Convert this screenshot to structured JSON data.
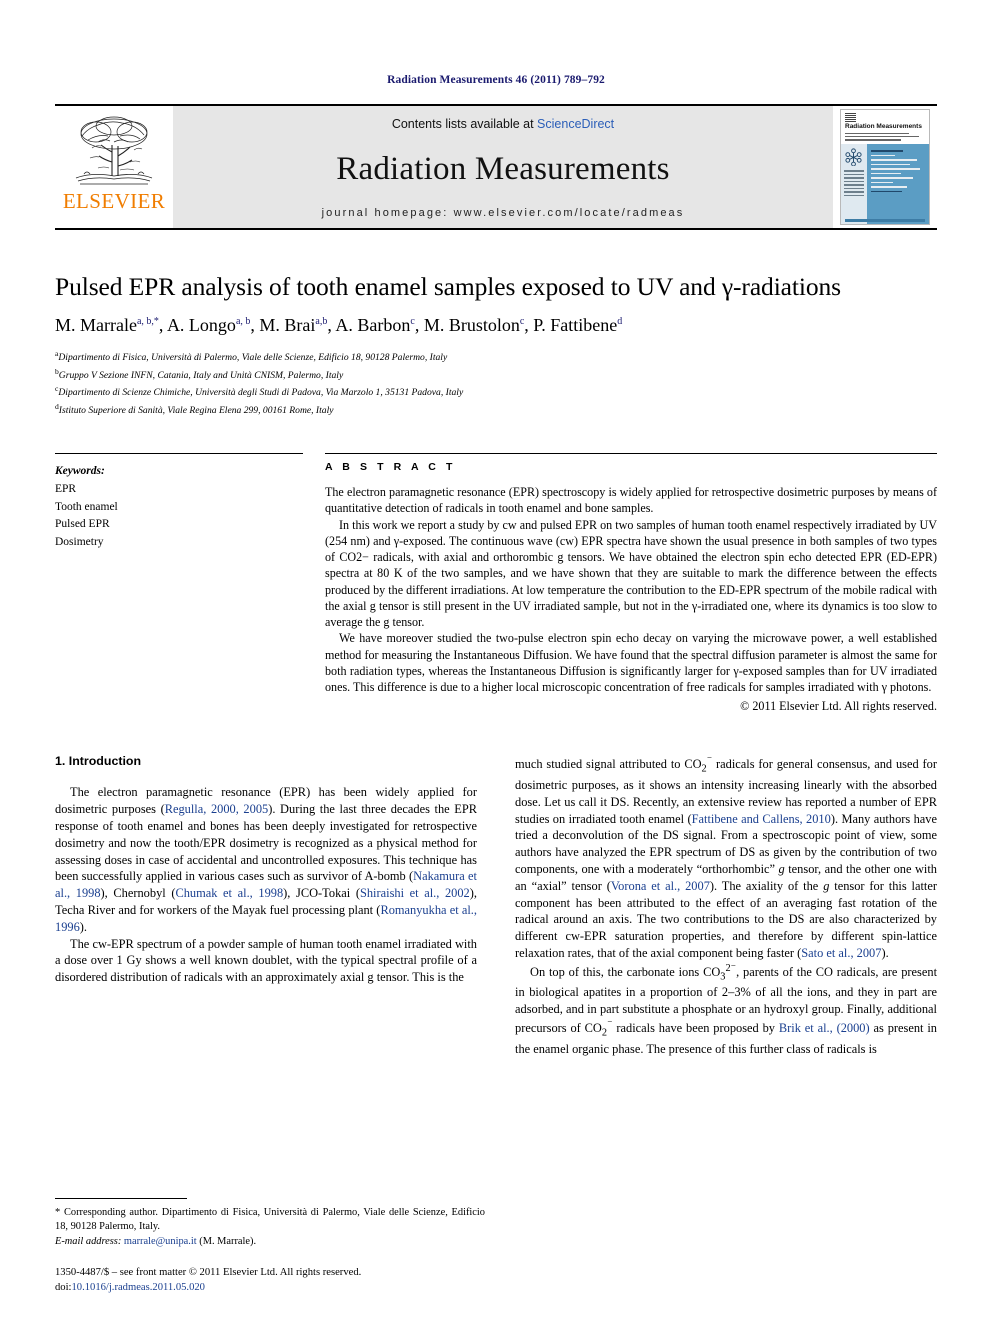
{
  "running_head": "Radiation Measurements 46 (2011) 789–792",
  "masthead": {
    "publisher": "ELSEVIER",
    "contents_prefix": "Contents lists available at ",
    "sciencedirect": "ScienceDirect",
    "journal_title": "Radiation Measurements",
    "homepage": "journal homepage: www.elsevier.com/locate/radmeas",
    "cover": {
      "title": "Radiation Measurements",
      "sub": "Volume 46 • 2011\nEditor-in-Chief: R. Chen • Associate Editors: S. W. S. McKeever\nA Journal for Radiation Research and Applications"
    }
  },
  "article": {
    "title": "Pulsed EPR analysis of tooth enamel samples exposed to UV and γ-radiations",
    "authors": [
      {
        "name": "M. Marrale",
        "sup": "a, b,*"
      },
      {
        "name": "A. Longo",
        "sup": "a, b"
      },
      {
        "name": "M. Brai",
        "sup": "a,b"
      },
      {
        "name": "A. Barbon",
        "sup": "c"
      },
      {
        "name": "M. Brustolon",
        "sup": "c"
      },
      {
        "name": "P. Fattibene",
        "sup": "d"
      }
    ],
    "affiliations": [
      {
        "mark": "a",
        "text": "Dipartimento di Fisica, Università di Palermo, Viale delle Scienze, Edificio 18, 90128 Palermo, Italy"
      },
      {
        "mark": "b",
        "text": "Gruppo V Sezione INFN, Catania, Italy and Unità CNISM, Palermo, Italy"
      },
      {
        "mark": "c",
        "text": "Dipartimento di Scienze Chimiche, Università degli Studi di Padova, Via Marzolo 1, 35131 Padova, Italy"
      },
      {
        "mark": "d",
        "text": "Istituto Superiore di Sanità, Viale Regina Elena 299, 00161 Rome, Italy"
      }
    ]
  },
  "keywords": {
    "heading": "Keywords:",
    "items": [
      "EPR",
      "Tooth enamel",
      "Pulsed EPR",
      "Dosimetry"
    ]
  },
  "abstract": {
    "heading": "A B S T R A C T",
    "paragraphs": [
      "The electron paramagnetic resonance (EPR) spectroscopy is widely applied for retrospective dosimetric purposes by means of quantitative detection of radicals in tooth enamel and bone samples.",
      "In this work we report a study by cw and pulsed EPR on two samples of human tooth enamel respectively irradiated by UV (254 nm) and γ-exposed. The continuous wave (cw) EPR spectra have shown the usual presence in both samples of two types of CO2− radicals, with axial and orthorombic g tensors. We have obtained the electron spin echo detected EPR (ED-EPR) spectra at 80 K of the two samples, and we have shown that they are suitable to mark the difference between the effects produced by the different irradiations. At low temperature the contribution to the ED-EPR spectrum of the mobile radical with the axial g tensor is still present in the UV irradiated sample, but not in the γ-irradiated one, where its dynamics is too slow to average the g tensor.",
      "We have moreover studied the two-pulse electron spin echo decay on varying the microwave power, a well established method for measuring the Instantaneous Diffusion. We have found that the spectral diffusion parameter is almost the same for both radiation types, whereas the Instantaneous Diffusion is significantly larger for γ-exposed samples than for UV irradiated ones. This difference is due to a higher local microscopic concentration of free radicals for samples irradiated with γ photons."
    ],
    "copyright": "© 2011 Elsevier Ltd. All rights reserved."
  },
  "intro": {
    "heading": "1. Introduction",
    "left_paragraphs": [
      "The electron paramagnetic resonance (EPR) has been widely applied for dosimetric purposes (Regulla, 2000, 2005). During the last three decades the EPR response of tooth enamel and bones has been deeply investigated for retrospective dosimetry and now the tooth/EPR dosimetry is recognized as a physical method for assessing doses in case of accidental and uncontrolled exposures. This technique has been successfully applied in various cases such as survivor of A-bomb (Nakamura et al., 1998), Chernobyl (Chumak et al., 1998), JCO-Tokai (Shiraishi et al., 2002), Techa River and for workers of the Mayak fuel processing plant (Romanyukha et al., 1996).",
      "The cw-EPR spectrum of a powder sample of human tooth enamel irradiated with a dose over 1 Gy shows a well known doublet, with the typical spectral profile of a disordered distribution of radicals with an approximately axial g tensor. This is the"
    ],
    "right_paragraphs": [
      "much studied signal attributed to CO2− radicals for general consensus, and used for dosimetric purposes, as it shows an intensity increasing linearly with the absorbed dose. Let us call it DS. Recently, an extensive review has reported a number of EPR studies on irradiated tooth enamel (Fattibene and Callens, 2010). Many authors have tried a deconvolution of the DS signal. From a spectroscopic point of view, some authors have analyzed the EPR spectrum of DS as given by the contribution of two components, one with a moderately “orthorhombic” g tensor, and the other one with an “axial” tensor (Vorona et al., 2007). The axiality of the g tensor for this latter component has been attributed to the effect of an averaging fast rotation of the radical around an axis. The two contributions to the DS are also characterized by different cw-EPR saturation properties, and therefore by different spin-lattice relaxation rates, that of the axial component being faster (Sato et al., 2007).",
      "On top of this, the carbonate ions CO32−, parents of the CO radicals, are present in biological apatites in a proportion of 2–3% of all the ions, and they in part are adsorbed, and in part substitute a phosphate or an hydroxyl group. Finally, additional precursors of CO2− radicals have been proposed by Brik et al., (2000) as present in the enamel organic phase. The presence of this further class of radicals is"
    ],
    "citations_left": [
      "Regulla, 2000, 2005",
      "Nakamura et al., 1998",
      "Chumak et al., 1998",
      "Shiraishi et al., 2002",
      "Romanyukha et al., 1996"
    ],
    "citations_right": [
      "Fattibene and Callens, 2010",
      "Vorona et al., 2007",
      "Sato et al., 2007",
      "Brik et al., (2000)"
    ]
  },
  "footnotes": {
    "corresponding_mark": "*",
    "corresponding": "Corresponding author. Dipartimento di Fisica, Università di Palermo, Viale delle Scienze, Edificio 18, 90128 Palermo, Italy.",
    "email_label": "E-mail address:",
    "email": "marrale@unipa.it",
    "email_suffix": "(M. Marrale)."
  },
  "imprint": {
    "issn_line": "1350-4487/$ – see front matter © 2011 Elsevier Ltd. All rights reserved.",
    "doi_label": "doi:",
    "doi": "10.1016/j.radmeas.2011.05.020"
  },
  "colors": {
    "elsevier_orange": "#f07d00",
    "link_blue": "#1a3f8f",
    "running_head_blue": "#1a1a6e",
    "masthead_grey": "#e6e6e6"
  }
}
